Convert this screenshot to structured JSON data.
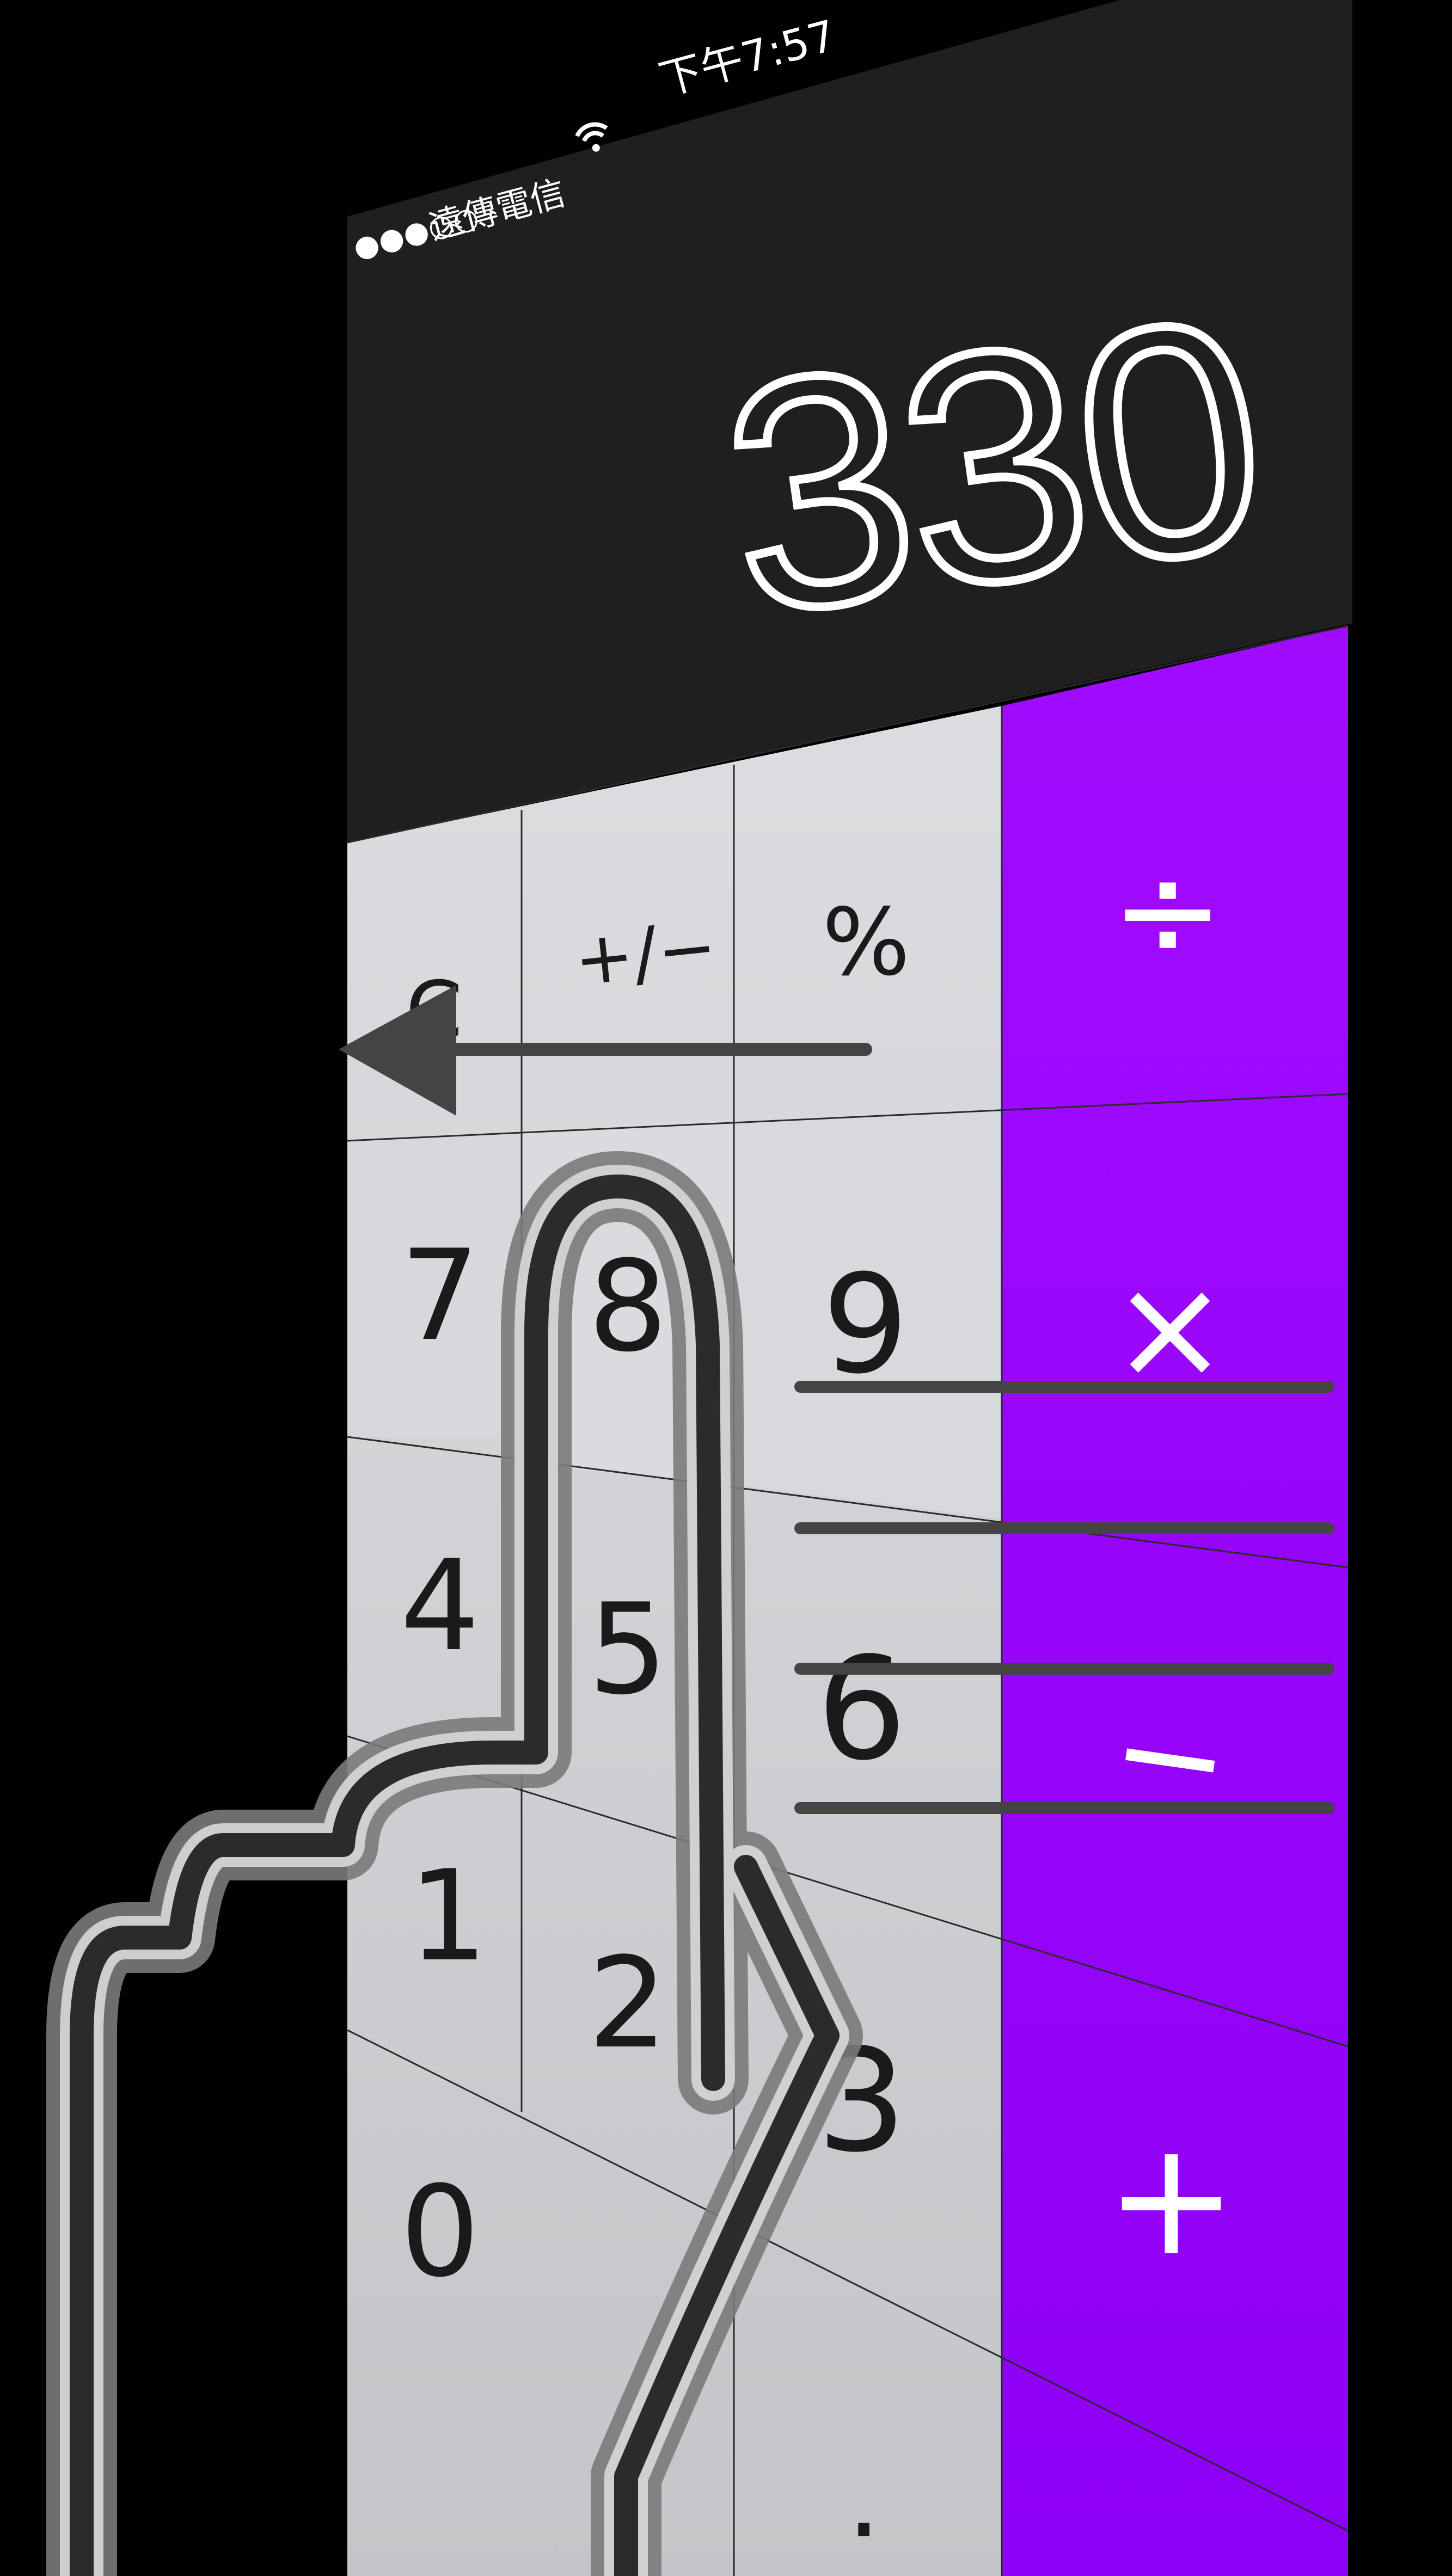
{
  "status_bar": {
    "signal_dots": "●●●○○",
    "carrier": "遠傳電信",
    "time": "下午7:57"
  },
  "display": {
    "value": "330"
  },
  "keys": {
    "clear": "C",
    "sign": "+/−",
    "percent": "%",
    "divide": "÷",
    "seven": "7",
    "eight": "8",
    "nine": "9",
    "multiply": "×",
    "four": "4",
    "five": "5",
    "six": "6",
    "minus": "−",
    "one": "1",
    "two": "2",
    "three": "3",
    "plus": "+",
    "zero": "0",
    "decimal": "."
  },
  "colors": {
    "background": "#000000",
    "display_bg": "#1f1f1f",
    "key_light": "#d3d4d6",
    "key_dark": "#c6c7c9",
    "operator": "#9a0cff",
    "overlay_gray": "#444444"
  },
  "icons": {
    "wifi": "wifi-icon",
    "swipe_arrow": "arrow-left-icon",
    "hand": "pointing-hand-icon"
  }
}
